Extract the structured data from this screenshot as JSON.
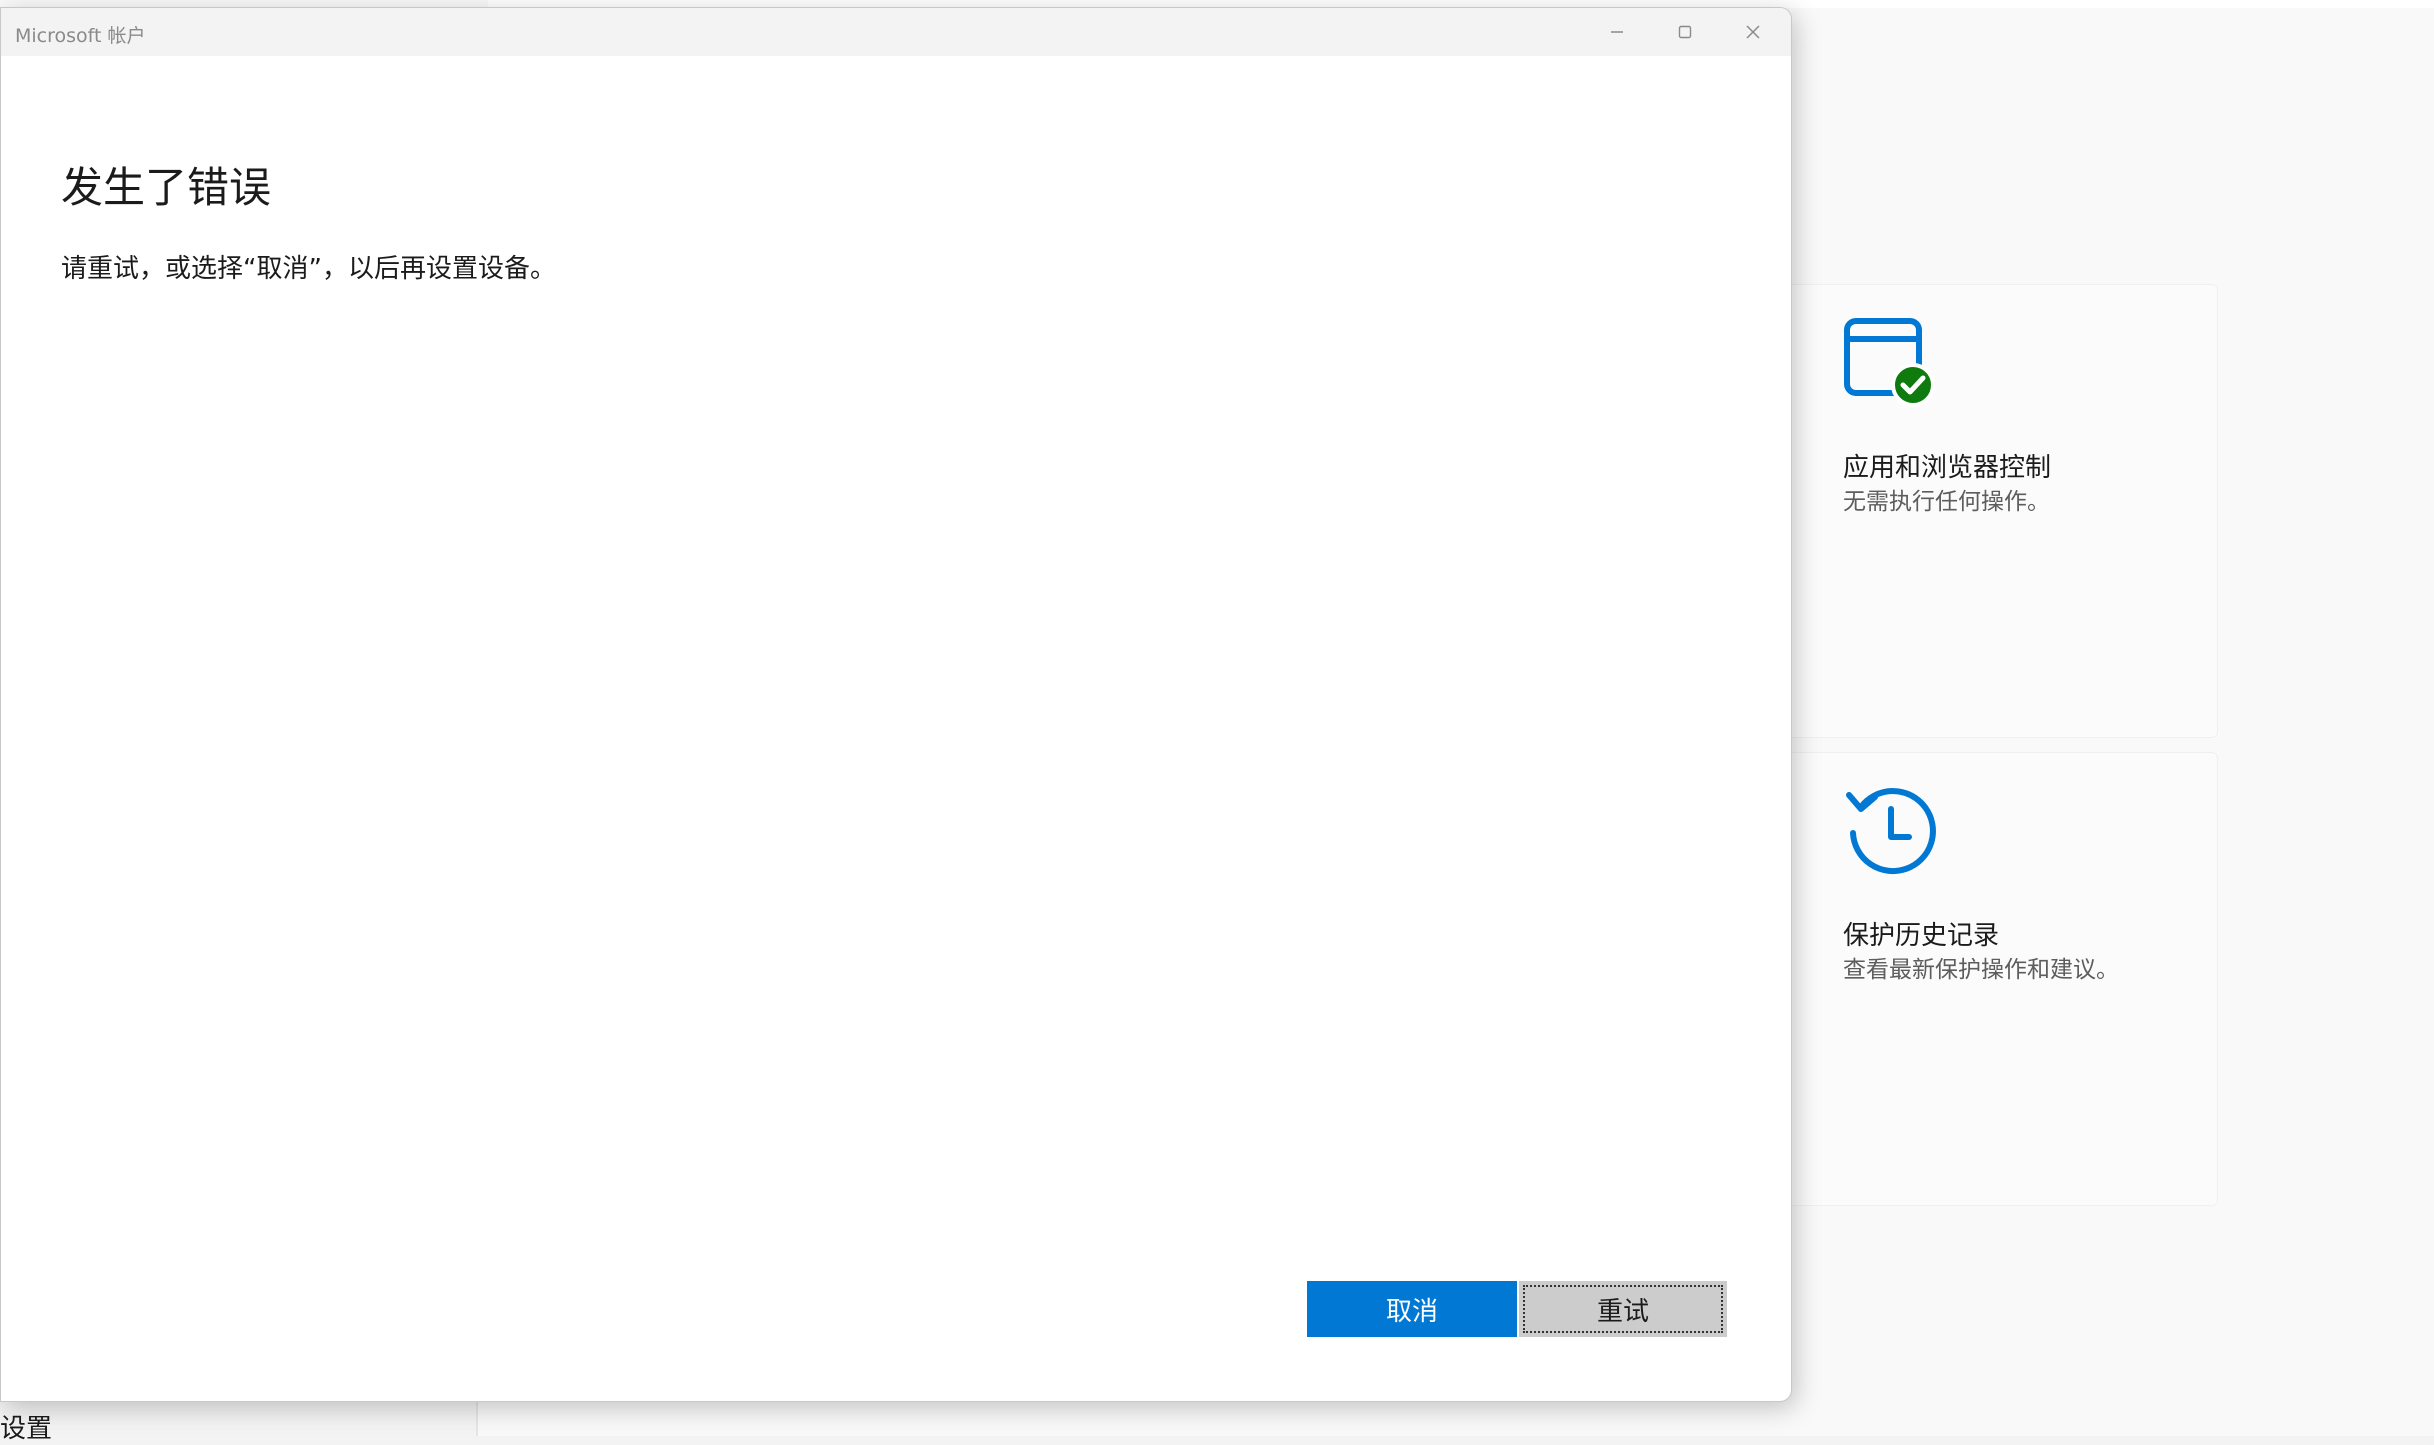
{
  "dialog": {
    "window_title": "Microsoft 帐户",
    "heading": "发生了错误",
    "message": "请重试，或选择“取消”，以后再设置设备。",
    "cancel_label": "取消",
    "retry_label": "重试"
  },
  "background": {
    "nav_label": "设置",
    "tiles": [
      {
        "title": "应用和浏览器控制",
        "subtitle": "无需执行任何操作。",
        "icon": "app-browser-control-icon",
        "status": "ok"
      },
      {
        "title": "保护历史记录",
        "subtitle": "查看最新保护操作和建议。",
        "icon": "protection-history-icon"
      }
    ]
  },
  "colors": {
    "accent": "#0078d4",
    "status_ok": "#0f7b0f",
    "retry_button_bg": "#cccccc"
  }
}
